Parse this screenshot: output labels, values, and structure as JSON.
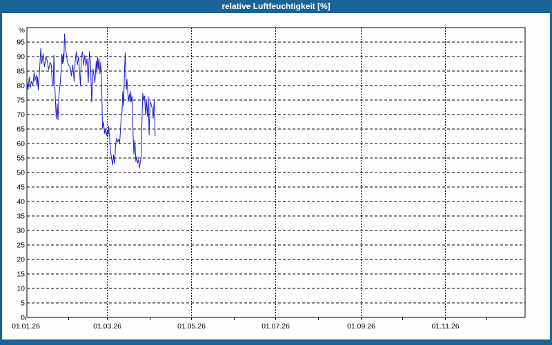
{
  "window": {
    "title": "relative Luftfeuchtigkeit [%]"
  },
  "colors": {
    "titlebar_bg": "#1a6397",
    "title_text": "#ffffff",
    "plot_bg": "#fdfefd",
    "grid": "#000000",
    "axis_text": "#000000",
    "line": "#1c1ccc"
  },
  "chart_data": {
    "type": "line",
    "title": "relative Luftfeuchtigkeit [%]",
    "xlabel": "",
    "ylabel": "%",
    "ylim": [
      0,
      100
    ],
    "y_tick_step": 5,
    "y_ticks": [
      0,
      5,
      10,
      15,
      20,
      25,
      30,
      35,
      40,
      45,
      50,
      55,
      60,
      65,
      70,
      75,
      80,
      85,
      90,
      95
    ],
    "grid": "dashed",
    "legend": "none",
    "x_start_date": "01.01.26",
    "x_axis_span_days": 362,
    "x_tick_labels": [
      {
        "day": 0,
        "label": "01.01.26"
      },
      {
        "day": 59,
        "label": "01.03.26"
      },
      {
        "day": 120,
        "label": "01.05.26"
      },
      {
        "day": 181,
        "label": "01.07.26"
      },
      {
        "day": 243,
        "label": "01.09.26"
      },
      {
        "day": 304,
        "label": "01.11.26"
      }
    ],
    "x_month_tick_days": [
      0,
      31,
      59,
      90,
      120,
      151,
      181,
      212,
      243,
      273,
      304,
      334
    ],
    "series": [
      {
        "name": "relative Luftfeuchtigkeit",
        "unit": "%",
        "points_day_value": [
          [
            1,
            81
          ],
          [
            1.5,
            78.5
          ],
          [
            2.5,
            83
          ],
          [
            3,
            79
          ],
          [
            4,
            81.5
          ],
          [
            5,
            80
          ],
          [
            6,
            84.5
          ],
          [
            6.5,
            81.5
          ],
          [
            7.5,
            83.5
          ],
          [
            8,
            80
          ],
          [
            8.5,
            83
          ],
          [
            9,
            78.5
          ],
          [
            10,
            86
          ],
          [
            10.8,
            92.8
          ],
          [
            11.5,
            87.5
          ],
          [
            12.5,
            91
          ],
          [
            13.5,
            86.5
          ],
          [
            14.5,
            90
          ],
          [
            15.5,
            88.5
          ],
          [
            16.5,
            85.5
          ],
          [
            17.5,
            88
          ],
          [
            18.5,
            87
          ],
          [
            19,
            81.5
          ],
          [
            19.8,
            80
          ],
          [
            20.3,
            90.5
          ],
          [
            21,
            79.5
          ],
          [
            21.5,
            74
          ],
          [
            22,
            68.5
          ],
          [
            22.7,
            73.8
          ],
          [
            23.3,
            68.2
          ],
          [
            24,
            77
          ],
          [
            25,
            81.3
          ],
          [
            25.7,
            87
          ],
          [
            26,
            90.8
          ],
          [
            26.5,
            87.5
          ],
          [
            27,
            91
          ],
          [
            27.5,
            88
          ],
          [
            28,
            97.8
          ],
          [
            28.7,
            93
          ],
          [
            29.3,
            90.9
          ],
          [
            30,
            88.3
          ],
          [
            31,
            87
          ],
          [
            32,
            86.5
          ],
          [
            33,
            83.3
          ],
          [
            34,
            87.1
          ],
          [
            35,
            81.4
          ],
          [
            35.7,
            88.3
          ],
          [
            36.5,
            91.7
          ],
          [
            37.3,
            87.1
          ],
          [
            38.2,
            90
          ],
          [
            38.8,
            85.7
          ],
          [
            39.5,
            80.2
          ],
          [
            40.2,
            90
          ],
          [
            41,
            91.7
          ],
          [
            41.8,
            87.1
          ],
          [
            42.7,
            90.5
          ],
          [
            43.5,
            86.7
          ],
          [
            44.3,
            89.3
          ],
          [
            45.2,
            81
          ],
          [
            46,
            91.7
          ],
          [
            46.8,
            88.3
          ],
          [
            47.7,
            74.3
          ],
          [
            48.7,
            85.7
          ],
          [
            50,
            81
          ],
          [
            51,
            88.5
          ],
          [
            51.5,
            84
          ],
          [
            52,
            89.8
          ],
          [
            52.5,
            85.7
          ],
          [
            53,
            89.4
          ],
          [
            53.7,
            84.1
          ],
          [
            54.3,
            88
          ],
          [
            55,
            78.6
          ],
          [
            55.5,
            65.2
          ],
          [
            56.3,
            67.4
          ],
          [
            57,
            63.5
          ],
          [
            57.7,
            65
          ],
          [
            58.3,
            62.8
          ],
          [
            59,
            64.5
          ],
          [
            59.5,
            62.5
          ],
          [
            60,
            65.9
          ],
          [
            60.7,
            61.9
          ],
          [
            61.3,
            57.6
          ],
          [
            62,
            55.2
          ],
          [
            62.8,
            52.6
          ],
          [
            63.5,
            56
          ],
          [
            64.3,
            53
          ],
          [
            65,
            59.5
          ],
          [
            65.8,
            61.9
          ],
          [
            66.5,
            60.5
          ],
          [
            67.3,
            61.5
          ],
          [
            68,
            60.3
          ],
          [
            68.5,
            64.3
          ],
          [
            69,
            68.6
          ],
          [
            69.7,
            71.2
          ],
          [
            70.2,
            77.9
          ],
          [
            70.8,
            72.9
          ],
          [
            71.5,
            85.7
          ],
          [
            72,
            91.4
          ],
          [
            72.5,
            83
          ],
          [
            72.8,
            78.6
          ],
          [
            73.3,
            82.1
          ],
          [
            74.2,
            74.5
          ],
          [
            75,
            77.1
          ],
          [
            75.5,
            74.3
          ],
          [
            76,
            77.9
          ],
          [
            76.5,
            74.5
          ],
          [
            77,
            76.2
          ],
          [
            77.7,
            62.9
          ],
          [
            78.3,
            56.2
          ],
          [
            79,
            61.2
          ],
          [
            79.7,
            53.8
          ],
          [
            80.3,
            55.5
          ],
          [
            81,
            53.2
          ],
          [
            81.7,
            54.5
          ],
          [
            82.3,
            51.5
          ],
          [
            83,
            53.8
          ],
          [
            83.5,
            55
          ],
          [
            84,
            65.7
          ],
          [
            84.7,
            77.4
          ],
          [
            85.3,
            75.2
          ],
          [
            86,
            76.4
          ],
          [
            86.7,
            70.2
          ],
          [
            87.3,
            75.2
          ],
          [
            88,
            69.3
          ],
          [
            88.7,
            76.2
          ],
          [
            89.3,
            62.9
          ],
          [
            90,
            74.5
          ],
          [
            90.7,
            73.6
          ],
          [
            91.7,
            71.9
          ],
          [
            92.3,
            68.6
          ],
          [
            93,
            75.2
          ],
          [
            93.7,
            62.5
          ]
        ]
      }
    ]
  }
}
